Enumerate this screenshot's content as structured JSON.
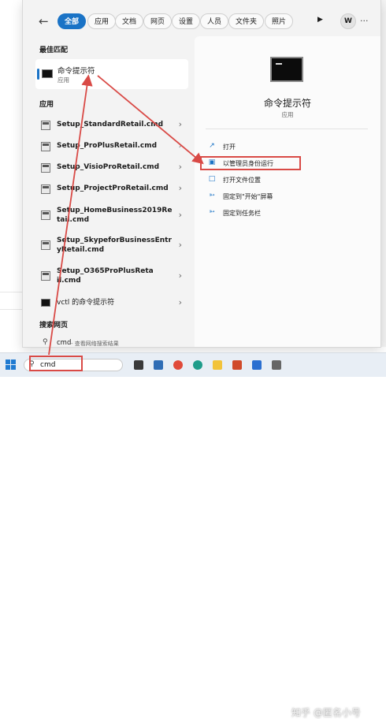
{
  "filters": {
    "back_icon": "back-arrow-icon",
    "chips": [
      "全部",
      "应用",
      "文档",
      "网页",
      "设置",
      "人员",
      "文件夹",
      "照片"
    ],
    "play_icon": "play-icon",
    "avatar": "W",
    "more_label": "..."
  },
  "best_match": {
    "section": "最佳匹配",
    "name": "命令提示符",
    "type": "应用"
  },
  "apps": {
    "section": "应用",
    "items": [
      "Setup_StandardRetail.cmd",
      "Setup_ProPlusRetail.cmd",
      "Setup_VisioProRetail.cmd",
      "Setup_ProjectProRetail.cmd",
      "Setup_HomeBusiness2019Retail.cmd",
      "Setup_SkypeforBusinessEntryRetail.cmd",
      "Setup_O365ProPlusRetail.cmd",
      "vctl 的命令提示符"
    ]
  },
  "web": {
    "section": "搜索网页",
    "query": "cmd",
    "hint": " - 查看网络搜索结果"
  },
  "detail": {
    "title": "命令提示符",
    "type": "应用",
    "actions": [
      "打开",
      "以管理员身份运行",
      "打开文件位置",
      "固定到\"开始\"屏幕",
      "固定到任务栏"
    ]
  },
  "taskbar": {
    "search_value": "cmd",
    "watermark": "知乎 @匿名小号"
  },
  "colors": {
    "accent": "#1a73c6",
    "annotation": "#d94a46"
  }
}
